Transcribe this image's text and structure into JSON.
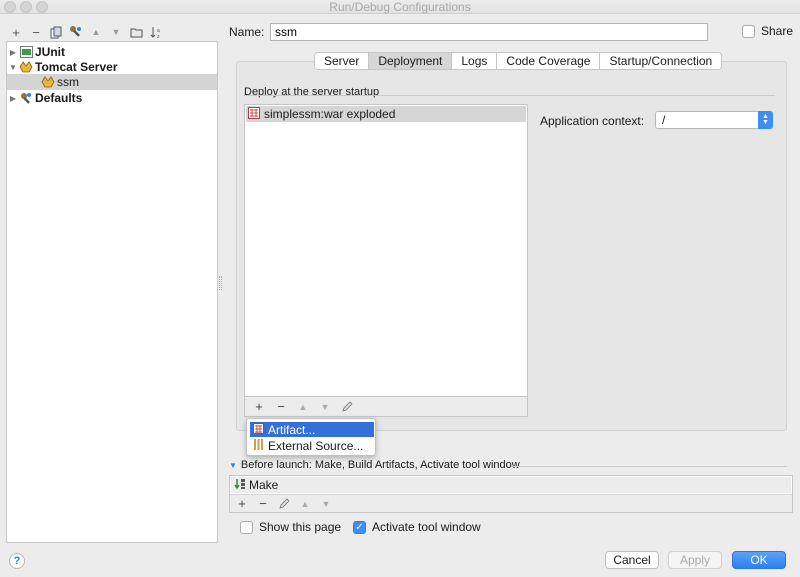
{
  "window": {
    "title": "Run/Debug Configurations"
  },
  "left_toolbar": {
    "buttons": [
      {
        "name": "add-config-button",
        "glyph": "+"
      },
      {
        "name": "remove-config-button",
        "glyph": "−"
      },
      {
        "name": "copy-config-button",
        "glyph": "❐"
      },
      {
        "name": "edit-defaults-button",
        "glyph": "✎"
      },
      {
        "name": "move-up-button",
        "glyph": "▲"
      },
      {
        "name": "move-down-button",
        "glyph": "▼"
      },
      {
        "name": "folder-button",
        "glyph": "▭"
      },
      {
        "name": "sort-button",
        "glyph": "↓"
      }
    ]
  },
  "tree": {
    "junit": "JUnit",
    "tomcat": "Tomcat Server",
    "ssm": "ssm",
    "defaults": "Defaults"
  },
  "name_label": "Name:",
  "name_value": "ssm",
  "share_label": "Share",
  "tabs": [
    "Server",
    "Deployment",
    "Logs",
    "Code Coverage",
    "Startup/Connection"
  ],
  "active_tab": "Deployment",
  "deploy_section_label": "Deploy at the server startup",
  "deploy_items": [
    "simplessm:war exploded"
  ],
  "app_context_label": "Application context:",
  "app_context_value": "/",
  "popup_menu": {
    "artifact": "Artifact...",
    "external": "External Source..."
  },
  "before_launch_label": "Before launch: Make, Build Artifacts, Activate tool window",
  "before_launch_items": [
    "Make"
  ],
  "show_page_label": "Show this page",
  "show_page_checked": false,
  "activate_label": "Activate tool window",
  "activate_checked": true,
  "buttons": {
    "help": "?",
    "cancel": "Cancel",
    "apply": "Apply",
    "ok": "OK"
  },
  "colors": {
    "accent": "#3d8ff2",
    "selection_highlight": "#3470d8"
  }
}
